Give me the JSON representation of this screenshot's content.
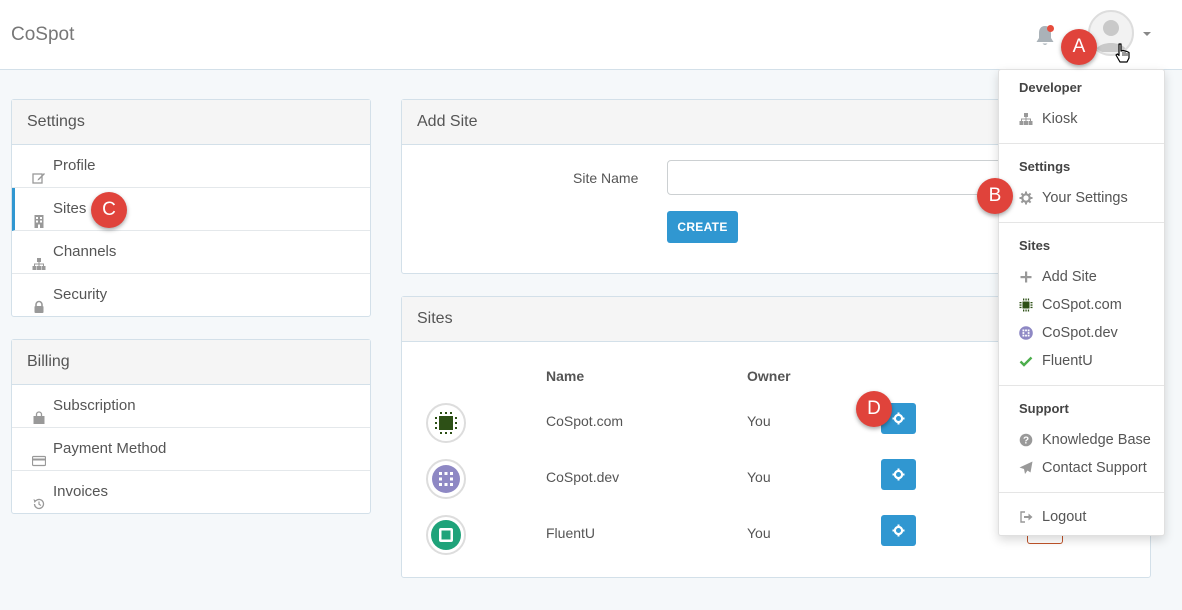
{
  "brand": "CoSpot",
  "callouts": {
    "a": "A",
    "b": "B",
    "c": "C",
    "d": "D"
  },
  "settings_panel": {
    "title": "Settings",
    "items": [
      {
        "label": "Profile",
        "icon": "edit-icon"
      },
      {
        "label": "Sites",
        "icon": "building-icon",
        "active": true
      },
      {
        "label": "Channels",
        "icon": "sitemap-icon"
      },
      {
        "label": "Security",
        "icon": "lock-icon"
      }
    ]
  },
  "billing_panel": {
    "title": "Billing",
    "items": [
      {
        "label": "Subscription",
        "icon": "shopping-bag-icon"
      },
      {
        "label": "Payment Method",
        "icon": "credit-card-icon"
      },
      {
        "label": "Invoices",
        "icon": "history-icon"
      }
    ]
  },
  "add_site": {
    "title": "Add Site",
    "field_label": "Site Name",
    "field_value": "",
    "create_label": "CREATE"
  },
  "sites": {
    "title": "Sites",
    "columns": {
      "name": "Name",
      "owner": "Owner"
    },
    "rows": [
      {
        "name": "CoSpot.com",
        "owner": "You",
        "icon_color": "#2d5016"
      },
      {
        "name": "CoSpot.dev",
        "owner": "You",
        "icon_color": "#8e88c4"
      },
      {
        "name": "FluentU",
        "owner": "You",
        "icon_color": "#1fa37a"
      }
    ]
  },
  "dropdown": {
    "developer": {
      "header": "Developer",
      "items": [
        {
          "label": "Kiosk",
          "icon": "sitemap-icon"
        }
      ]
    },
    "settings": {
      "header": "Settings",
      "items": [
        {
          "label": "Your Settings",
          "icon": "gear-icon"
        }
      ]
    },
    "sites": {
      "header": "Sites",
      "items": [
        {
          "label": "Add Site",
          "icon": "plus-icon"
        },
        {
          "label": "CoSpot.com",
          "icon": "chip-icon"
        },
        {
          "label": "CoSpot.dev",
          "icon": "grid-icon"
        },
        {
          "label": "FluentU",
          "icon": "check-icon"
        }
      ]
    },
    "support": {
      "header": "Support",
      "items": [
        {
          "label": "Knowledge Base",
          "icon": "question-icon"
        },
        {
          "label": "Contact Support",
          "icon": "paper-plane-icon"
        }
      ]
    },
    "logout": {
      "label": "Logout",
      "icon": "sign-out-icon"
    }
  },
  "colors": {
    "accent": "#3097d1",
    "callout": "#e0433b",
    "notification": "#e74c3c"
  }
}
